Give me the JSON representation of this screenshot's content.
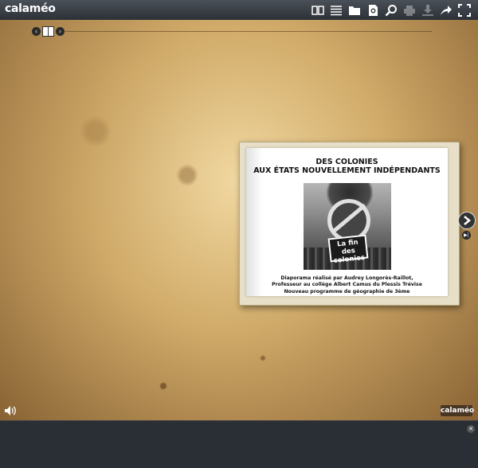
{
  "app": {
    "logo_text": "calaméo"
  },
  "toolbar": {
    "icons": [
      "book-view-icon",
      "list-view-icon",
      "folder-icon",
      "search-doc-icon",
      "zoom-icon",
      "print-icon",
      "download-icon",
      "share-icon",
      "fullscreen-icon"
    ],
    "disabled": [
      "print-icon",
      "download-icon"
    ]
  },
  "document": {
    "title_line1": "DES COLONIES",
    "title_line2": "AUX ÉTATS NOUVELLEMENT INDÉPENDANTS",
    "image_caption": "La fin des colonies",
    "credit_line1": "Diaporama réalisé par Audrey Longorès-Raillot,",
    "credit_line2": "Professeur au collège Albert Camus du Plessis Trévise",
    "credit_line3": "Nouveau programme de géographie de 3ème"
  },
  "watermark": {
    "text": "calaméo"
  },
  "colors": {
    "toolbar_bg": "#2c3137",
    "bottom_bg": "#2a2f35",
    "paper_bg": "#c9a15f"
  }
}
